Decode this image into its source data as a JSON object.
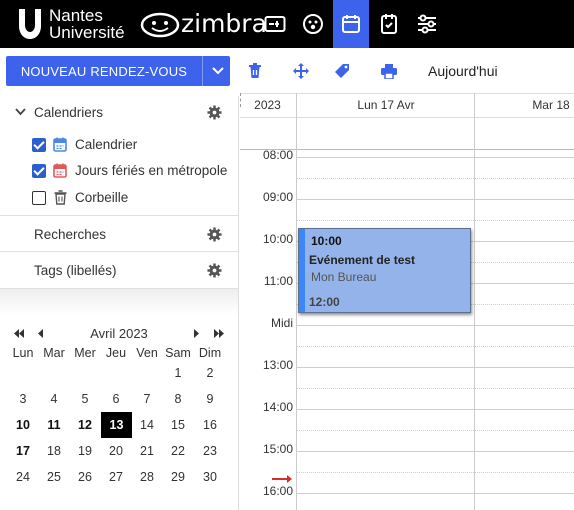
{
  "brand": {
    "university_line1": "Nantes",
    "university_line2": "Université",
    "app_name": "zimbra"
  },
  "top_apps": [
    "mail-app-icon",
    "contacts-app-icon",
    "calendar-app-icon",
    "tasks-app-icon",
    "preferences-app-icon"
  ],
  "active_app": "calendar",
  "toolbar": {
    "new_appointment": "NOUVEAU RENDEZ-VOUS",
    "today": "Aujourd'hui"
  },
  "sidebar": {
    "calendars_header": "Calendriers",
    "calendars": [
      {
        "label": "Calendrier",
        "checked": true,
        "icon_color": "#4b88e6"
      },
      {
        "label": "Jours fériés en métropole",
        "checked": true,
        "icon_color": "#e05a5a"
      },
      {
        "label": "Corbeille",
        "checked": false
      }
    ],
    "searches": "Recherches",
    "tags": "Tags (libellés)"
  },
  "mini_calendar": {
    "month": "Avril 2023",
    "weekdays": [
      "Lun",
      "Mar",
      "Mer",
      "Jeu",
      "Ven",
      "Sam",
      "Dim"
    ],
    "weeks": [
      [
        "",
        "",
        "",
        "",
        "",
        "1",
        "2"
      ],
      [
        "3",
        "4",
        "5",
        "6",
        "7",
        "8",
        "9"
      ],
      [
        "10",
        "11",
        "12",
        "13",
        "14",
        "15",
        "16"
      ],
      [
        "17",
        "18",
        "19",
        "20",
        "21",
        "22",
        "23"
      ],
      [
        "24",
        "25",
        "26",
        "27",
        "28",
        "29",
        "30"
      ]
    ],
    "today": "13",
    "bold_days": [
      "10",
      "11",
      "12",
      "17"
    ]
  },
  "calendar": {
    "year": "2023",
    "days": [
      "Lun 17 Avr",
      "Mar 18"
    ],
    "hours": [
      "08:00",
      "09:00",
      "10:00",
      "11:00",
      "Midi",
      "13:00",
      "14:00",
      "15:00",
      "16:00"
    ],
    "event": {
      "start": "10:00",
      "title": "Evénement de test",
      "location": "Mon Bureau",
      "end": "12:00"
    }
  }
}
